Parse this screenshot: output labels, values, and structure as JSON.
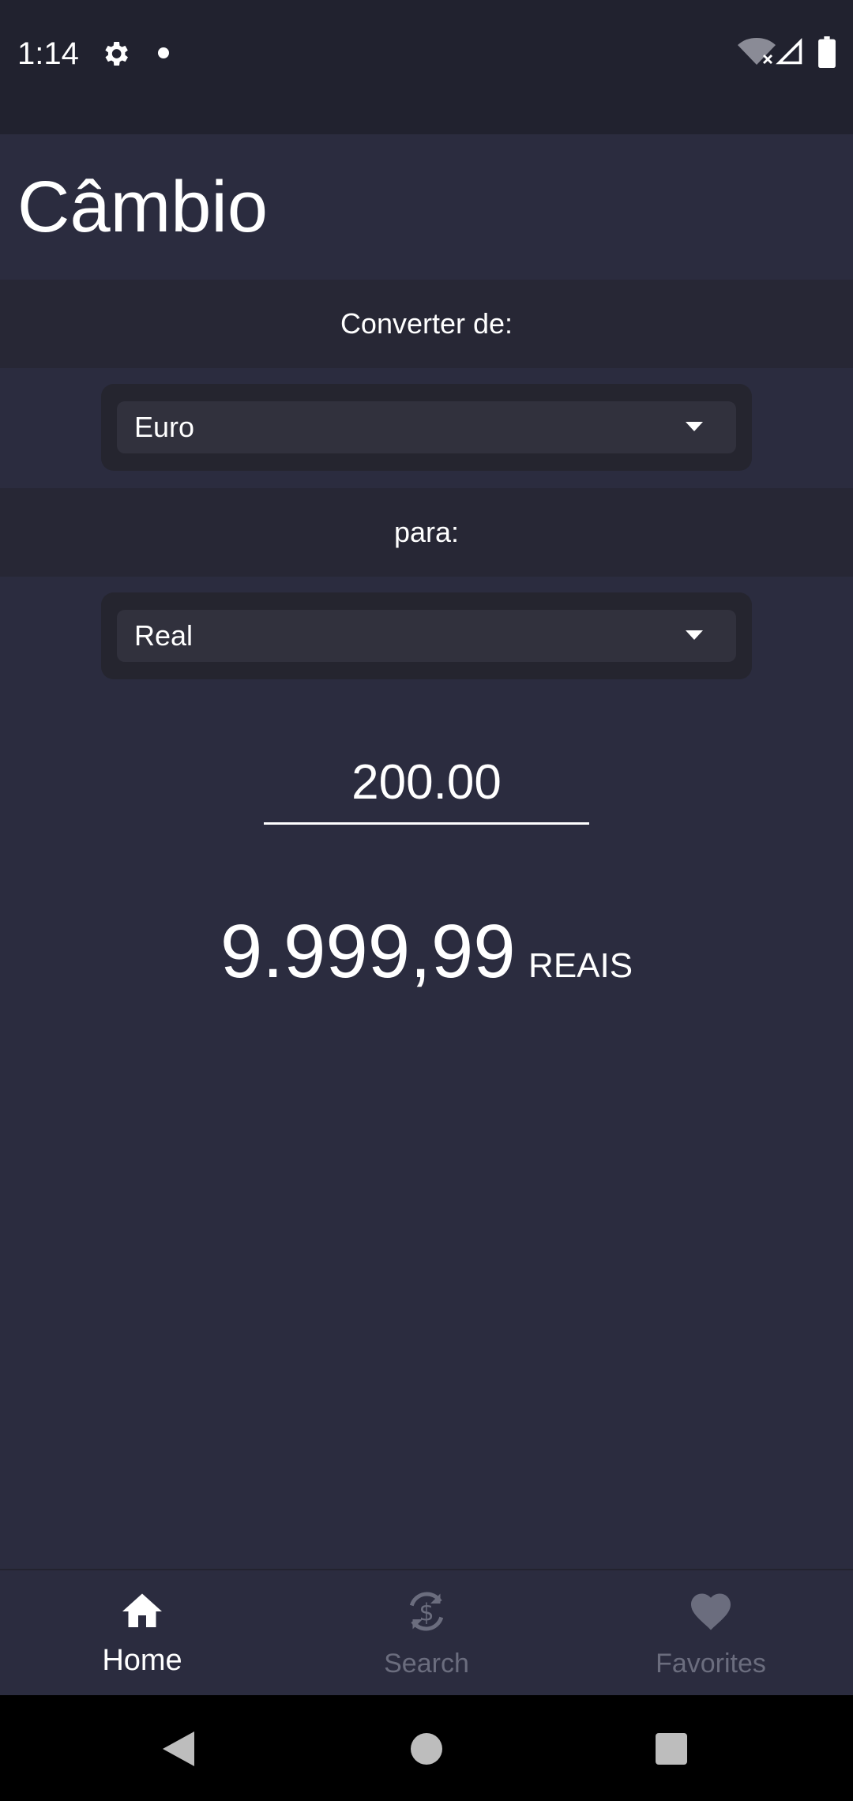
{
  "status_bar": {
    "time": "1:14",
    "icons": [
      "gear-icon",
      "notification-dot-icon",
      "wifi-off-icon",
      "signal-icon",
      "battery-icon"
    ]
  },
  "header": {
    "title": "Câmbio"
  },
  "converter": {
    "from_label": "Converter de:",
    "from_currency": "Euro",
    "to_label": "para:",
    "to_currency": "Real",
    "amount": "200.00",
    "result_value": "9.999,99",
    "result_unit": "REAIS"
  },
  "bottom_nav": {
    "items": [
      {
        "label": "Home",
        "icon": "home-icon",
        "active": true
      },
      {
        "label": "Search",
        "icon": "currency-exchange-icon",
        "active": false
      },
      {
        "label": "Favorites",
        "icon": "heart-icon",
        "active": false
      }
    ]
  },
  "system_nav": {
    "icons": [
      "back-icon",
      "home-circle-icon",
      "recents-icon"
    ]
  },
  "colors": {
    "background": "#2b2c3f",
    "status_bar": "#21222f",
    "band": "#272735",
    "select_bg": "#31313d",
    "inactive_nav": "#6b6d7e",
    "text": "#ffffff"
  }
}
